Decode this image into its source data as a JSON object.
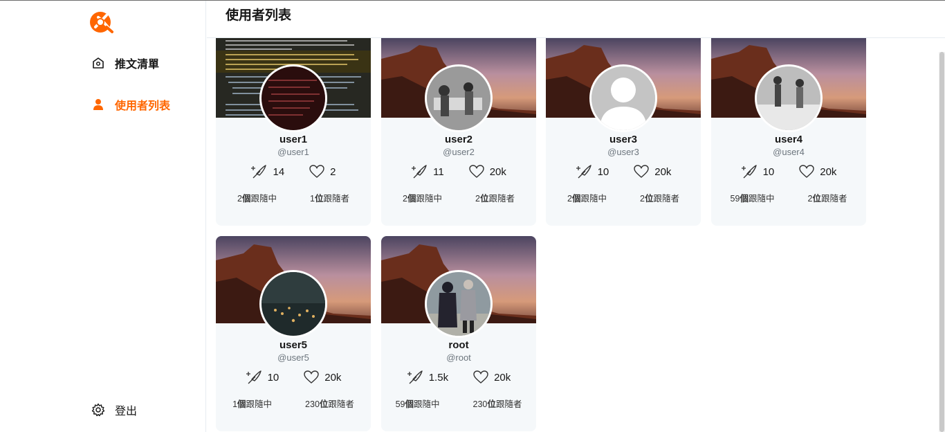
{
  "app": {
    "brand_color": "#ff6600",
    "logo_icon": "alphitter-logo-icon"
  },
  "sidebar": {
    "items": [
      {
        "label": "推文清單",
        "icon": "home-icon",
        "active": false
      },
      {
        "label": "使用者列表",
        "icon": "user-icon",
        "active": true
      }
    ],
    "logout": {
      "label": "登出",
      "icon": "gear-icon"
    }
  },
  "header": {
    "title": "使用者列表"
  },
  "users": [
    {
      "name": "user1",
      "account": "@user1",
      "tweets": "14",
      "likes": "2",
      "following_num": "2",
      "following_label": "個",
      "following_suffix": "跟隨中",
      "followers_num": "1",
      "followers_label": "位",
      "followers_suffix": "跟隨者"
    },
    {
      "name": "user2",
      "account": "@user2",
      "tweets": "11",
      "likes": "20k",
      "following_num": "2",
      "following_label": "個",
      "following_suffix": "跟隨中",
      "followers_num": "2",
      "followers_label": "位",
      "followers_suffix": "跟隨者"
    },
    {
      "name": "user3",
      "account": "@user3",
      "tweets": "10",
      "likes": "20k",
      "following_num": "2",
      "following_label": "個",
      "following_suffix": "跟隨中",
      "followers_num": "2",
      "followers_label": "位",
      "followers_suffix": "跟隨者"
    },
    {
      "name": "user4",
      "account": "@user4",
      "tweets": "10",
      "likes": "20k",
      "following_num": "59",
      "following_label": "個",
      "following_suffix": "跟隨中",
      "followers_num": "2",
      "followers_label": "位",
      "followers_suffix": "跟隨者"
    },
    {
      "name": "user5",
      "account": "@user5",
      "tweets": "10",
      "likes": "20k",
      "following_num": "1",
      "following_label": "個",
      "following_suffix": "跟隨中",
      "followers_num": "230",
      "followers_label": "位",
      "followers_suffix": "跟隨者"
    },
    {
      "name": "root",
      "account": "@root",
      "tweets": "1.5k",
      "likes": "20k",
      "following_num": "59",
      "following_label": "個",
      "following_suffix": "跟隨中",
      "followers_num": "230",
      "followers_label": "位",
      "followers_suffix": "跟隨者"
    }
  ]
}
